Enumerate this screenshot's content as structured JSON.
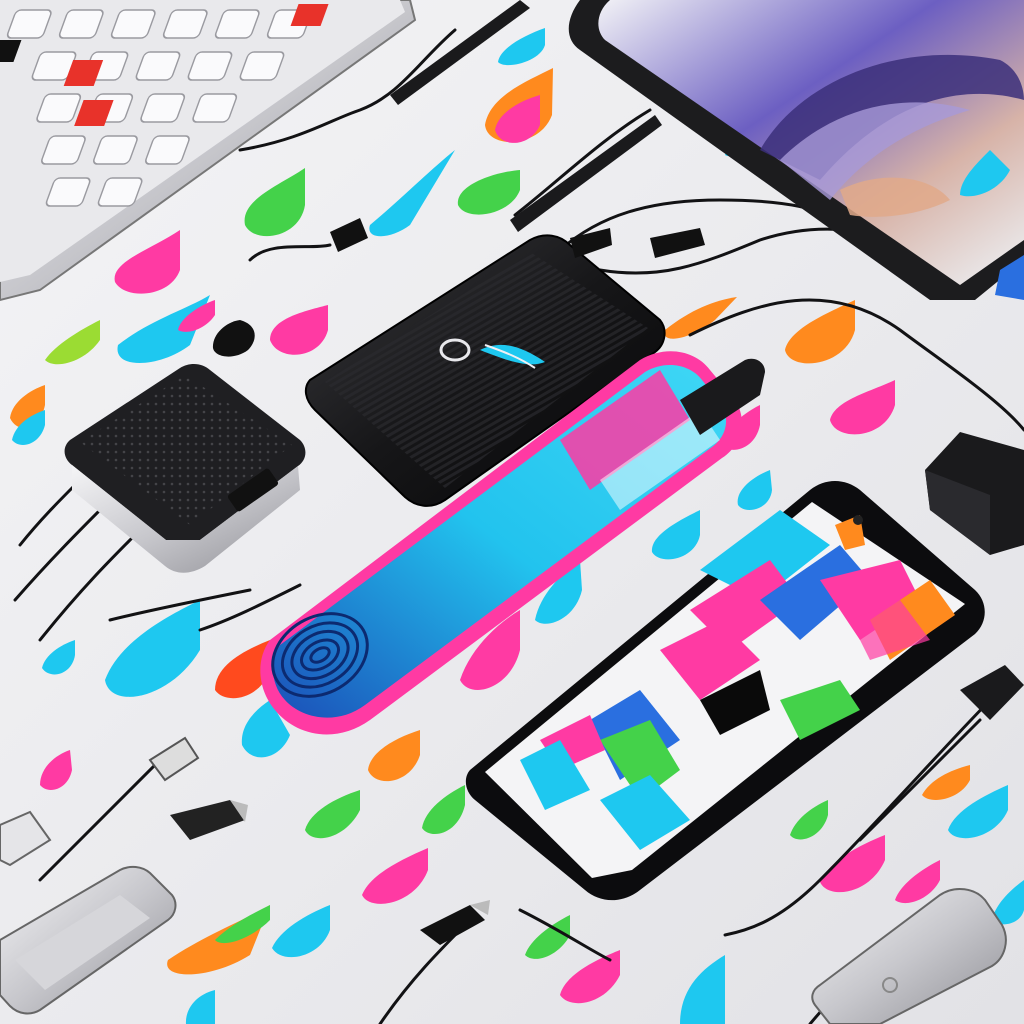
{
  "scene": {
    "description_hidden": "",
    "palette": {
      "background": "#ececee",
      "device_black": "#1a1a1c",
      "device_silver": "#c9c9cc",
      "cable": "#111111",
      "pink": "#ff3aa3",
      "cyan": "#1ec8f0",
      "green": "#44d24a",
      "orange": "#ff8a1e",
      "blue": "#2a6fe0",
      "purple": "#8a5cf0"
    },
    "objects": [
      {
        "name": "keyboard",
        "icon": "keyboard-icon"
      },
      {
        "name": "tablet-top-right",
        "icon": "tablet-icon"
      },
      {
        "name": "smartphone-foreground",
        "icon": "smartphone-icon"
      },
      {
        "name": "power-bank-black",
        "icon": "battery-icon"
      },
      {
        "name": "usb-hub-black",
        "icon": "hub-icon"
      },
      {
        "name": "fingerprint-usb-stick",
        "icon": "fingerprint-icon"
      },
      {
        "name": "earphones",
        "icon": "earphones-icon"
      },
      {
        "name": "usb-flash-drives",
        "icon": "usb-icon"
      },
      {
        "name": "external-drive-silver",
        "icon": "drive-icon"
      },
      {
        "name": "wall-adapter",
        "icon": "plug-icon"
      }
    ]
  }
}
